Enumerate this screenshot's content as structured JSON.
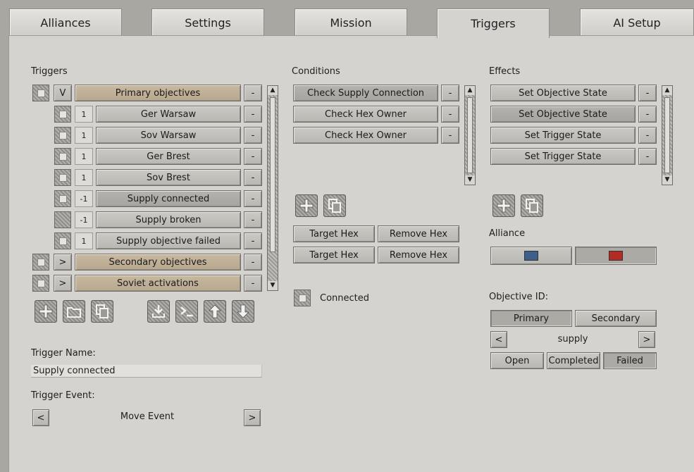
{
  "tabs": [
    "Alliances",
    "Settings",
    "Mission",
    "Triggers",
    "AI Setup"
  ],
  "triggers": {
    "heading": "Triggers",
    "groups": {
      "primary": {
        "toggle": "V",
        "label": "Primary objectives"
      },
      "secondary": {
        "toggle": ">",
        "label": "Secondary objectives"
      },
      "soviet": {
        "toggle": ">",
        "label": "Soviet activations"
      }
    },
    "items": [
      {
        "num": "1",
        "label": "Ger Warsaw"
      },
      {
        "num": "1",
        "label": "Sov Warsaw"
      },
      {
        "num": "1",
        "label": "Ger Brest"
      },
      {
        "num": "1",
        "label": "Sov Brest"
      },
      {
        "num": "-1",
        "label": "Supply connected"
      },
      {
        "num": "-1",
        "label": "Supply broken"
      },
      {
        "num": "1",
        "label": "Supply objective failed"
      }
    ],
    "remove": "-",
    "name_label": "Trigger Name:",
    "name_value": "Supply connected",
    "event_label": "Trigger Event:",
    "event_value": "Move Event",
    "prev": "<",
    "next": ">"
  },
  "conditions": {
    "heading": "Conditions",
    "items": [
      "Check Supply Connection",
      "Check Hex Owner",
      "Check Hex Owner"
    ],
    "remove": "-",
    "target_hex": "Target Hex",
    "remove_hex": "Remove Hex",
    "connected_label": "Connected"
  },
  "effects": {
    "heading": "Effects",
    "items": [
      "Set Objective State",
      "Set Objective State",
      "Set Trigger State",
      "Set Trigger State"
    ],
    "remove": "-",
    "alliance_label": "Alliance",
    "alliance_colors": [
      "#3d5f8a",
      "#b52a22"
    ],
    "objective_label": "Objective ID:",
    "primary": "Primary",
    "secondary": "Secondary",
    "objective_value": "supply",
    "prev": "<",
    "next": ">",
    "states": [
      "Open",
      "Completed",
      "Failed"
    ]
  },
  "icons": {
    "scroll_up": "▲",
    "scroll_down": "▼"
  }
}
